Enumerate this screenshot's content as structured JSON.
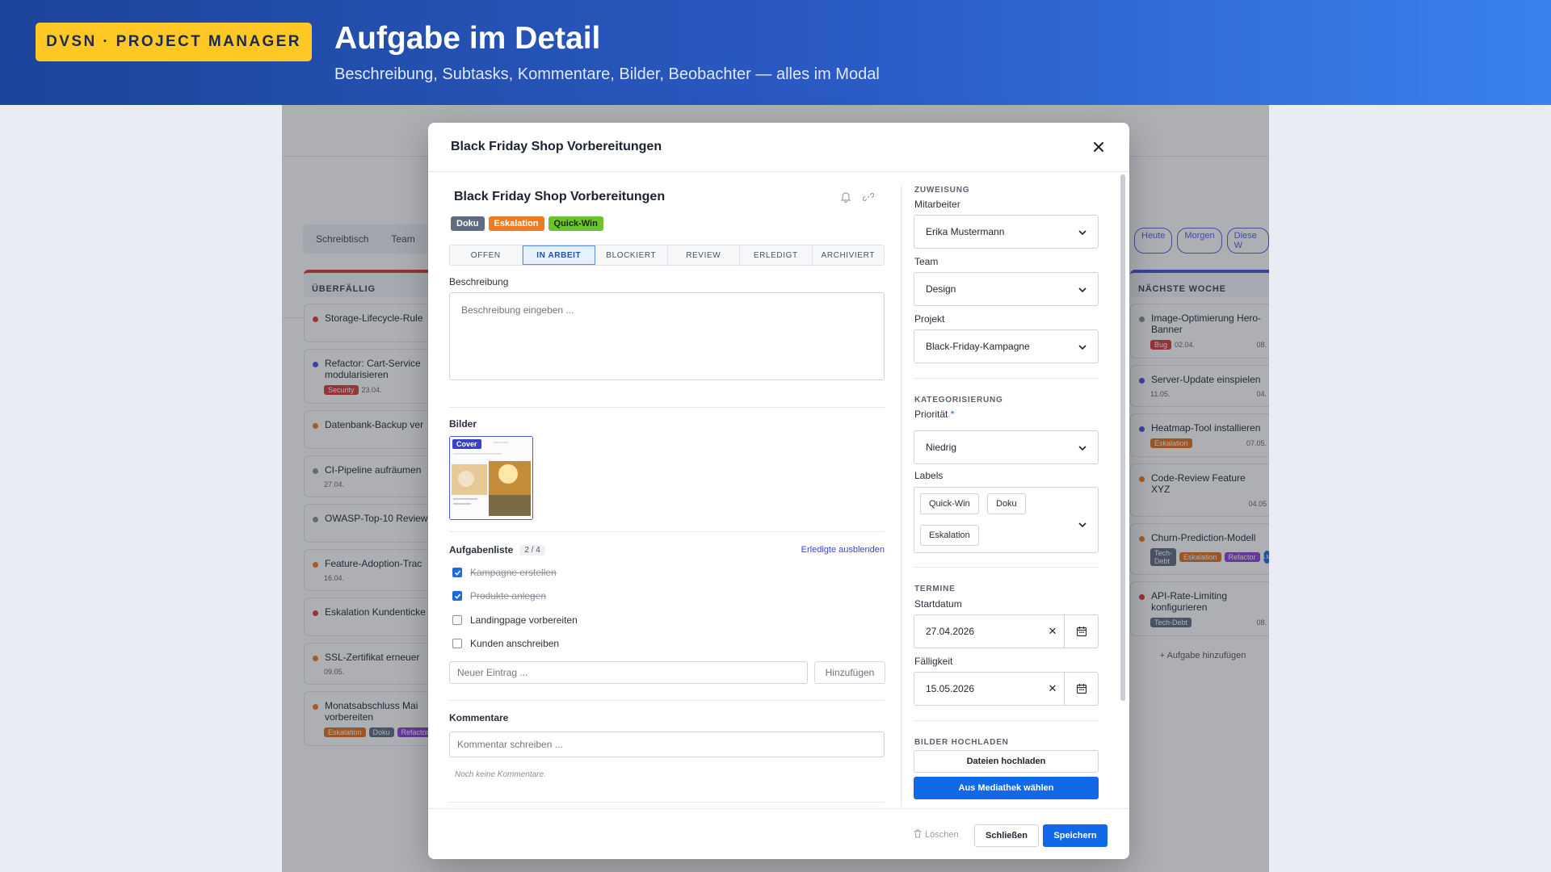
{
  "banner": {
    "badge": "DVSN · PROJECT MANAGER",
    "title": "Aufgabe im Detail",
    "subtitle": "Beschreibung, Subtasks, Kommentare, Bilder, Beobachter — alles im Modal"
  },
  "background": {
    "tabs": [
      "Schreibtisch",
      "Team"
    ],
    "quick_filters": [
      "Heute",
      "Morgen",
      "Diese W"
    ],
    "left_column": {
      "title": "ÜBERFÄLLIG",
      "cards": [
        {
          "title": "Storage-Lifecycle-Rule",
          "dot": "#d83b3b"
        },
        {
          "title": "Refactor: Cart-Service modularisieren",
          "dot": "#4b52d8",
          "tag": "Security",
          "date": "23.04."
        },
        {
          "title": "Datenbank-Backup ver",
          "dot": "#f07a20"
        },
        {
          "title": "CI-Pipeline aufräumen",
          "dot": "#8a909c",
          "date": "27.04."
        },
        {
          "title": "OWASP-Top-10 Review",
          "dot": "#8a909c"
        },
        {
          "title": "Feature-Adoption-Trac",
          "dot": "#f07a20",
          "date": "16.04."
        },
        {
          "title": "Eskalation Kundenticke",
          "dot": "#d83b3b"
        },
        {
          "title": "SSL-Zertifikat erneuer",
          "dot": "#f07a20",
          "date": "09.05."
        },
        {
          "title": "Monatsabschluss Mai vorbereiten",
          "dot": "#f07a20",
          "tags": [
            "Eskalation",
            "Doku",
            "Refactor"
          ]
        }
      ]
    },
    "right_column": {
      "title": "NÄCHSTE WOCHE",
      "cards": [
        {
          "title": "Image-Optimierung Hero-Banner",
          "dot": "#8a909c",
          "tag": "Bug",
          "date": "02.04.",
          "extra": "08."
        },
        {
          "title": "Server-Update einspielen",
          "dot": "#4b52d8",
          "date": "11.05.",
          "extra": "04."
        },
        {
          "title": "Heatmap-Tool installieren",
          "dot": "#4b52d8",
          "tag": "Eskalation",
          "extra": "07.05."
        },
        {
          "title": "Code-Review Feature XYZ",
          "dot": "#f07a20",
          "extra": "04.05"
        },
        {
          "title": "Churn-Prediction-Modell",
          "dot": "#f07a20",
          "tags": [
            "Tech-Debt",
            "Eskalation",
            "Refactor"
          ],
          "avatar": "LM"
        },
        {
          "title": "API-Rate-Limiting konfigurieren",
          "dot": "#d83b3b",
          "tag": "Tech-Debt",
          "extra": "08."
        }
      ],
      "add": "Aufgabe hinzufügen"
    }
  },
  "modal": {
    "title": "Black Friday Shop Vorbereitungen",
    "task_title": "Black Friday Shop Vorbereitungen",
    "tags": [
      "Doku",
      "Eskalation",
      "Quick-Win"
    ],
    "statuses": [
      "OFFEN",
      "IN ARBEIT",
      "BLOCKIERT",
      "REVIEW",
      "ERLEDIGT",
      "ARCHIVIERT"
    ],
    "active_status": "IN ARBEIT",
    "description_label": "Beschreibung",
    "description_placeholder": "Beschreibung eingeben ...",
    "images_label": "Bilder",
    "cover_label": "Cover",
    "checklist_label": "Aufgabenliste",
    "checklist_count": "2 / 4",
    "hide_done": "Erledigte ausblenden",
    "checklist": [
      {
        "text": "Kampagne erstellen",
        "done": true
      },
      {
        "text": "Produkte anlegen",
        "done": true
      },
      {
        "text": "Landingpage vorbereiten",
        "done": false
      },
      {
        "text": "Kunden anschreiben",
        "done": false
      }
    ],
    "new_entry_placeholder": "Neuer Eintrag ...",
    "add_label": "Hinzufügen",
    "comments_label": "Kommentare",
    "comment_placeholder": "Kommentar schreiben ...",
    "no_comments": "Noch keine Kommentare.",
    "assignment": {
      "group": "ZUWEISUNG",
      "employee_label": "Mitarbeiter",
      "employee": "Erika Mustermann",
      "team_label": "Team",
      "team": "Design",
      "project_label": "Projekt",
      "project": "Black-Friday-Kampagne"
    },
    "categorization": {
      "group": "KATEGORISIERUNG",
      "priority_label": "Priorität",
      "required_mark": "*",
      "priority": "Niedrig",
      "labels_label": "Labels",
      "labels": [
        "Quick-Win",
        "Doku",
        "Eskalation"
      ]
    },
    "dates": {
      "group": "TERMINE",
      "start_label": "Startdatum",
      "start": "27.04.2026",
      "due_label": "Fälligkeit",
      "due": "15.05.2026"
    },
    "upload": {
      "group": "BILDER HOCHLADEN",
      "files": "Dateien hochladen",
      "library": "Aus Mediathek wählen"
    },
    "footer": {
      "delete": "Löschen",
      "close": "Schließen",
      "save": "Speichern"
    }
  }
}
